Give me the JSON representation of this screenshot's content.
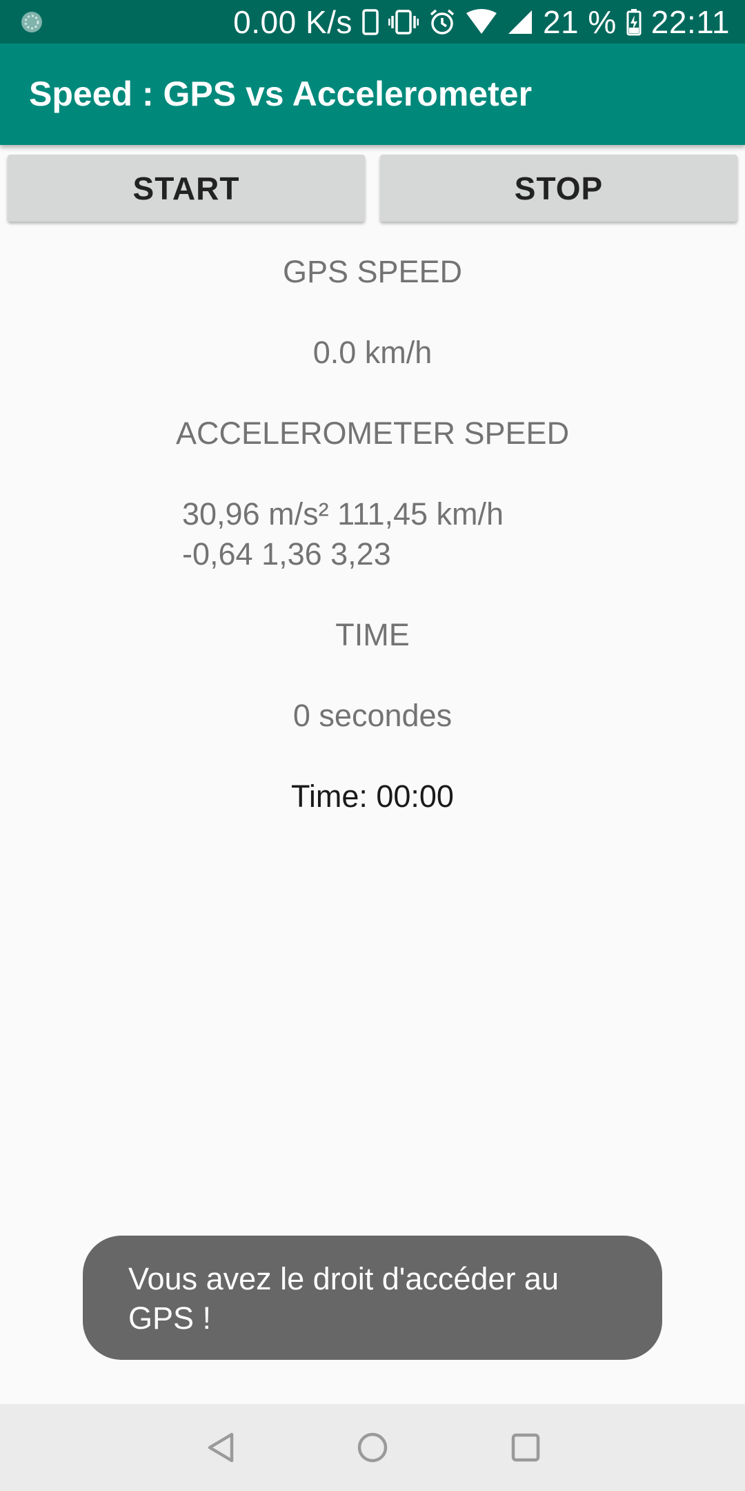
{
  "status_bar": {
    "network_speed": "0.00 K/s",
    "battery_percent": "21 %",
    "clock": "22:11",
    "icons": [
      "app-notification-icon",
      "phone-icon",
      "vibrate-icon",
      "alarm-icon",
      "wifi-icon",
      "signal-icon",
      "battery-icon"
    ]
  },
  "app_bar": {
    "title": "Speed : GPS vs Accelerometer"
  },
  "buttons": {
    "start_label": "START",
    "stop_label": "STOP"
  },
  "content": {
    "gps_heading": "GPS SPEED",
    "gps_value": "0.0 km/h",
    "accel_heading": "ACCELEROMETER SPEED",
    "accel_line1": "30,96 m/s² 111,45 km/h",
    "accel_line2": "-0,64 1,36 3,23",
    "time_heading": "TIME",
    "time_seconds": "0 secondes",
    "time_clock": "Time: 00:00"
  },
  "toast": {
    "message": "Vous avez le droit d'accéder au GPS !"
  },
  "nav_bar": {
    "icons": [
      "back-icon",
      "home-icon",
      "recents-icon"
    ]
  },
  "colors": {
    "status_bar": "#00695c",
    "app_bar": "#00897b",
    "button": "#d6d7d7",
    "toast": "#676767",
    "nav_bar": "#ebebeb"
  }
}
